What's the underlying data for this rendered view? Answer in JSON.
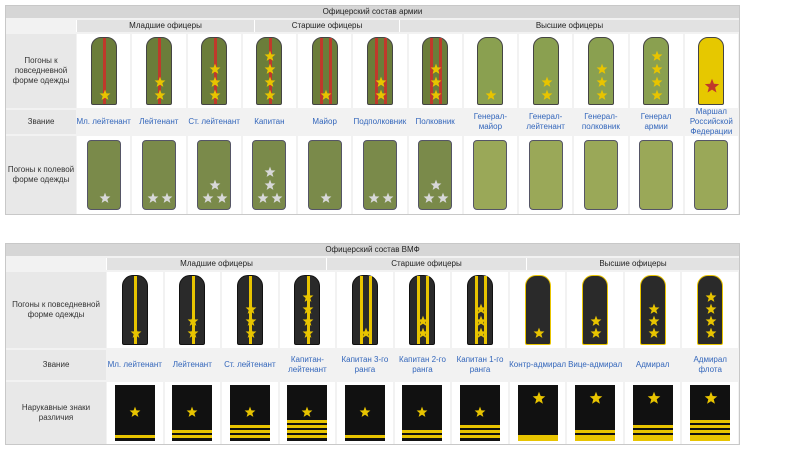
{
  "army": {
    "title": "Офицерский состав армии",
    "groups": [
      "Младшие офицеры",
      "Старшие офицеры",
      "Высшие офицеры"
    ],
    "row_daily": "Погоны к повседневной форме одежды",
    "row_rank": "Звание",
    "row_field": "Погоны к полевой форме одежды",
    "ranks": [
      "Мл. лейтенант",
      "Лейтенант",
      "Ст. лейтенант",
      "Капитан",
      "Майор",
      "Подполковник",
      "Полковник",
      "Генерал-майор",
      "Генерал-лейтенант",
      "Генерал-полковник",
      "Генерал армии",
      "Маршал Российской Федерации"
    ],
    "stars": [
      1,
      2,
      3,
      4,
      1,
      2,
      3,
      1,
      2,
      3,
      4,
      1
    ],
    "colors": {
      "daily": "#6b7d3a",
      "stripe": "#c0392b",
      "star": "#e8c400",
      "field": "#7a8a4a",
      "general": "#8aa050",
      "marshal": "#e6c800"
    }
  },
  "navy": {
    "title": "Офицерский состав ВМФ",
    "groups": [
      "Младшие офицеры",
      "Старшие офицеры",
      "Высшие офицеры"
    ],
    "row_daily": "Погоны к повседневной форме одежды",
    "row_rank": "Звание",
    "row_sleeve": "Нарукавные знаки различия",
    "ranks": [
      "Мл. лейтенант",
      "Лейтенант",
      "Ст. лейтенант",
      "Капитан-лейтенант",
      "Капитан 3-го ранга",
      "Капитан 2-го ранга",
      "Капитан 1-го ранга",
      "Контр-адмирал",
      "Вице-адмирал",
      "Адмирал",
      "Адмирал флота"
    ],
    "stars": [
      1,
      2,
      3,
      4,
      1,
      2,
      3,
      1,
      2,
      3,
      4
    ],
    "colors": {
      "strap": "#2a2a2a",
      "stripe": "#e8c400",
      "star": "#e8c400",
      "sleeve": "#111111"
    }
  }
}
